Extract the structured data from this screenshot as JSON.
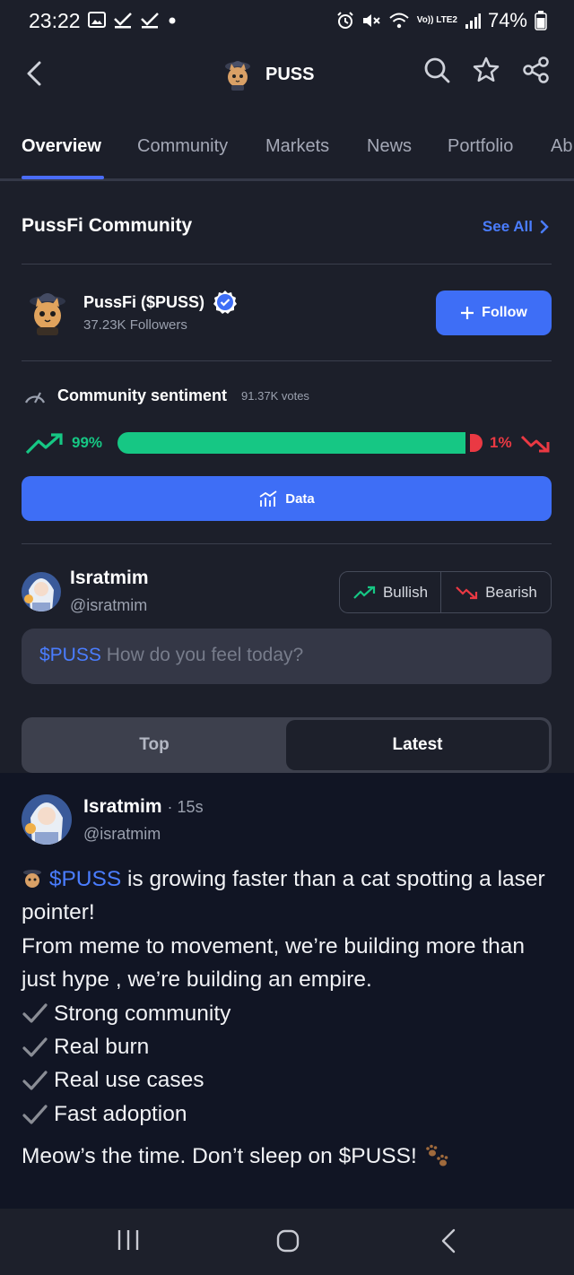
{
  "status_bar": {
    "time": "23:22",
    "battery": "74%",
    "network": "Vo)) LTE2",
    "icons_left": [
      "image-icon",
      "check-icon",
      "check-icon",
      "dot-icon"
    ],
    "icons_right": [
      "alarm-icon",
      "mute-icon",
      "wifi-icon",
      "signal-icon",
      "battery-icon"
    ]
  },
  "header": {
    "title": "PUSS",
    "back_icon": "chevron-left-icon",
    "actions": [
      "search-icon",
      "star-icon",
      "share-icon"
    ]
  },
  "tabs": [
    "Overview",
    "Community",
    "Markets",
    "News",
    "Portfolio",
    "Ab"
  ],
  "active_tab": "Overview",
  "community": {
    "section_title": "PussFi Community",
    "see_all": "See All",
    "name": "PussFi ($PUSS)",
    "followers": "37.23K Followers",
    "follow_label": "Follow"
  },
  "sentiment": {
    "title": "Community sentiment",
    "votes": "91.37K votes",
    "bullish_pct_label": "99%",
    "bearish_pct_label": "1%",
    "bullish_fraction": 0.99,
    "data_button": "Data",
    "colors": {
      "bullish": "#16c784",
      "bearish": "#ea3943",
      "accent": "#3e6ef6"
    }
  },
  "composer": {
    "user_name": "Isratmim",
    "user_handle": "@isratmim",
    "bullish_label": "Bullish",
    "bearish_label": "Bearish",
    "tag": "$PUSS",
    "placeholder": "How do you feel today?"
  },
  "feed_tabs": {
    "top": "Top",
    "latest": "Latest",
    "selected": "Latest"
  },
  "post": {
    "author": "Isratmim",
    "time": "· 15s",
    "handle": "@isratmim",
    "line1_tag": "$PUSS",
    "line1_text": " is growing faster than a cat spotting a laser pointer!",
    "line2": "From meme to movement, we’re building more than just hype , we’re building an empire.",
    "checks": [
      "Strong community",
      "Real burn",
      "Real use cases",
      "Fast adoption"
    ],
    "footer": "Meow’s the time. Don’t sleep on $PUSS!"
  },
  "nav_bar": [
    "recents-icon",
    "home-icon",
    "back-icon"
  ]
}
